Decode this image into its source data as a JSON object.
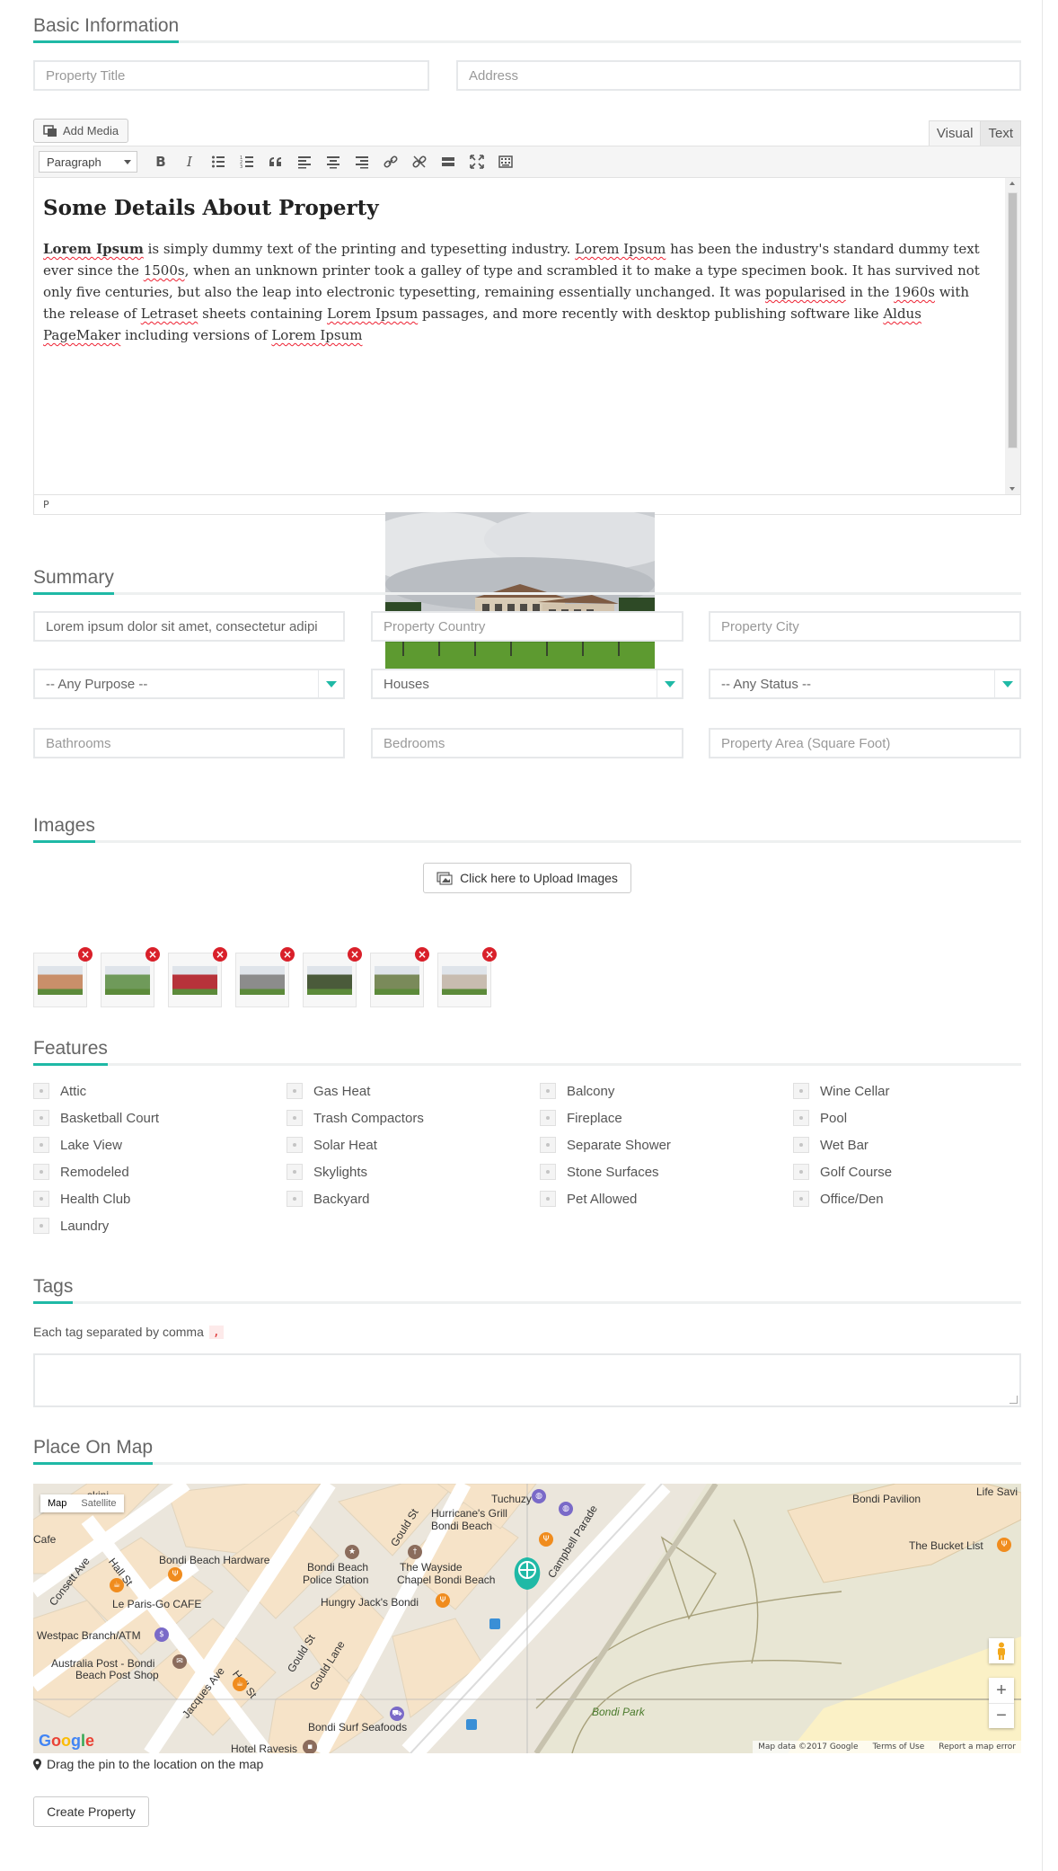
{
  "sections": {
    "basic": "Basic Information",
    "summary": "Summary",
    "images": "Images",
    "features": "Features",
    "tags": "Tags",
    "map": "Place On Map"
  },
  "basic": {
    "title_placeholder": "Property Title",
    "address_placeholder": "Address"
  },
  "editor": {
    "add_media": "Add Media",
    "tab_visual": "Visual",
    "tab_text": "Text",
    "format": "Paragraph",
    "heading": "Some Details About Property",
    "p_bold": "Lorem Ipsum",
    "p_1": " is simply dummy text of the printing and typesetting industry. ",
    "p_sp1": "Lorem Ipsum",
    "p_2": " has been the industry's standard dummy text ever since the ",
    "p_sp2": "1500s",
    "p_3": ", when an unknown printer took a galley of type and scrambled it to make a type specimen book. It has survived not only five centuries, but also the leap into electronic typesetting, remaining essentially unchanged. It was ",
    "p_sp3": "popularised",
    "p_4": " in the ",
    "p_sp4": "1960s",
    "p_5": " with the release of ",
    "p_sp5": "Letraset",
    "p_6": " sheets containing ",
    "p_sp6": "Lorem Ipsum",
    "p_7": " passages, and more recently with desktop publishing software like ",
    "p_sp7": "Aldus PageMaker",
    "p_8": " including versions of ",
    "p_sp8": "Lorem Ipsum",
    "status_path": "P"
  },
  "summary": {
    "summary_value": "Lorem ipsum dolor sit amet, consectetur adipi",
    "country_placeholder": "Property Country",
    "city_placeholder": "Property City",
    "purpose": "-- Any Purpose --",
    "type": "Houses",
    "status": "-- Any Status --",
    "bathrooms_placeholder": "Bathrooms",
    "bedrooms_placeholder": "Bedrooms",
    "area_placeholder": "Property Area (Square Foot)"
  },
  "images": {
    "upload_label": "Click here to Upload Images",
    "thumb_colors": [
      "#c98f6a",
      "#6f9a5a",
      "#b7323a",
      "#8c8c8c",
      "#4a5a3a",
      "#7a8a5a",
      "#c8bcb0"
    ],
    "remove_glyph": "×"
  },
  "features": {
    "col1": [
      "Attic",
      "Basketball Court",
      "Lake View",
      "Remodeled",
      "Health Club",
      "Laundry"
    ],
    "col2": [
      "Gas Heat",
      "Trash Compactors",
      "Solar Heat",
      "Skylights",
      "Backyard"
    ],
    "col3": [
      "Balcony",
      "Fireplace",
      "Separate Shower",
      "Stone Surfaces",
      "Pet Allowed"
    ],
    "col4": [
      "Wine Cellar",
      "Pool",
      "Wet Bar",
      "Golf Course",
      "Office/Den"
    ]
  },
  "tags": {
    "hint": "Each tag separated by comma",
    "separator": ","
  },
  "map": {
    "type_map": "Map",
    "type_satellite": "Satellite",
    "google": "Google",
    "footer_data": "Map data ©2017 Google",
    "footer_terms": "Terms of Use",
    "footer_report": "Report a map error",
    "zoom_in": "+",
    "zoom_out": "−",
    "labels": {
      "tuchuzy": "Tuchuzy",
      "hurricanes": "Hurricane's Grill",
      "hurricanes2": "Bondi Beach",
      "campbell": "Campbell Parade",
      "bondi_pavilion": "Bondi Pavilion",
      "life_saving": "Life Savi",
      "bucket_list": "The Bucket List",
      "bondi_hardware": "Bondi Beach Hardware",
      "bondi_police": "Bondi Beach",
      "bondi_police2": "Police Station",
      "wayside": "The Wayside",
      "wayside2": "Chapel Bondi Beach",
      "hungry_jacks": "Hungry Jack's Bondi",
      "le_paris": "Le Paris-Go CAFE",
      "westpac": "Westpac Branch/ATM",
      "aus_post": "Australia Post - Bondi",
      "aus_post2": "Beach Post Shop",
      "bondi_surf": "Bondi Surf Seafoods",
      "hotel_ravesis": "Hotel Ravesis",
      "bondi_park": "Bondi Park",
      "hall_st": "Hall St",
      "gould_st": "Gould St",
      "gould_lane": "Gould Lane",
      "consett": "Consett Ave",
      "jacques": "Jacques Ave",
      "skini": "skini",
      "cafe": "Cafe"
    },
    "hint": "Drag the pin to the location on the map",
    "accent": "#1fb9a6"
  },
  "actions": {
    "create": "Create Property"
  }
}
